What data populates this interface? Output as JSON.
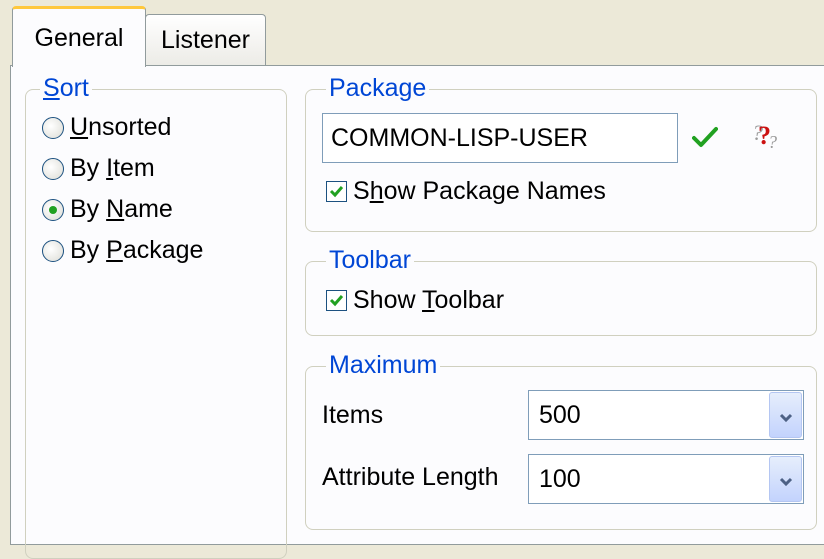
{
  "tabs": [
    {
      "label": "General",
      "active": true
    },
    {
      "label": "Listener",
      "active": false
    }
  ],
  "sort": {
    "title": "Sort",
    "title_parts": [
      "",
      "S",
      "ort"
    ],
    "options": [
      {
        "parts": [
          "",
          "U",
          "nsorted"
        ],
        "checked": false
      },
      {
        "parts": [
          "By ",
          "I",
          "tem"
        ],
        "checked": false
      },
      {
        "parts": [
          "By ",
          "N",
          "ame"
        ],
        "checked": true
      },
      {
        "parts": [
          "By ",
          "P",
          "ackage"
        ],
        "checked": false
      }
    ]
  },
  "package": {
    "title": "Package",
    "value": "COMMON-LISP-USER",
    "show_names": {
      "parts": [
        "S",
        "h",
        "ow Package Names"
      ],
      "checked": true
    },
    "confirm_icon": "green-checkmark-icon",
    "help_icon": "question-mark-icon"
  },
  "toolbar": {
    "title": "Toolbar",
    "show_toolbar": {
      "parts": [
        "Show ",
        "T",
        "oolbar"
      ],
      "checked": true
    }
  },
  "maximum": {
    "title": "Maximum",
    "items_label": "Items",
    "items_value": "500",
    "attr_label": "Attribute Length",
    "attr_value": "100"
  },
  "colors": {
    "group_title": "#0046d5",
    "tab_highlight": "#ffc83c",
    "checkmark": "#21a121"
  }
}
